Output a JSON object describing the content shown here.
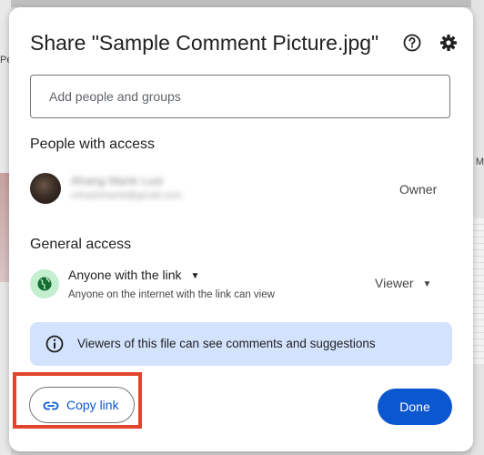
{
  "background": {
    "left_tab_text": "Pe",
    "right_text": "M"
  },
  "dialog": {
    "title": "Share \"Sample Comment Picture.jpg\"",
    "help_icon": "help-circle-icon",
    "settings_icon": "gear-icon"
  },
  "add_people": {
    "placeholder": "Add people and groups"
  },
  "people_with_access": {
    "heading": "People with access",
    "person": {
      "name": "Ahang Marie Lusi",
      "email": "mhashmarie@gmail.com",
      "role": "Owner"
    }
  },
  "general_access": {
    "heading": "General access",
    "type": "Anyone with the link",
    "description": "Anyone on the internet with the link can view",
    "role": "Viewer",
    "icon": "globe-icon"
  },
  "info_banner": {
    "text": "Viewers of this file can see comments and suggestions",
    "icon": "info-icon"
  },
  "footer": {
    "copy_link_label": "Copy link",
    "done_label": "Done"
  },
  "colors": {
    "accent": "#0b57d0",
    "banner_bg": "#d3e3fd",
    "globe_bg": "#c4eed0",
    "highlight": "#e0452b"
  }
}
